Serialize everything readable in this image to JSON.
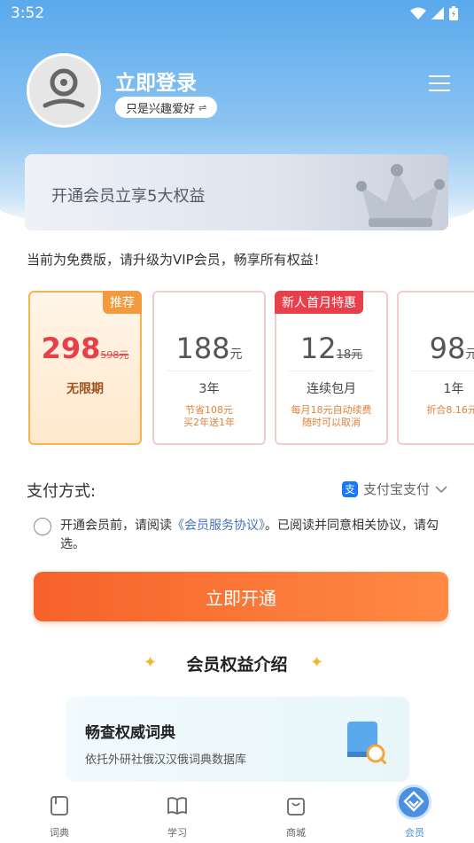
{
  "status_bar": {
    "time": "3:52"
  },
  "header": {
    "login_title": "立即登录",
    "interest_label": "只是兴趣爱好",
    "interest_swap_glyph": "⇌"
  },
  "banner": {
    "text": "开通会员立享5大权益"
  },
  "free_note": "当前为免费版，请升级为VIP会员，畅享所有权益！",
  "plans": [
    {
      "badge": "推荐",
      "price": "298",
      "original": "598元",
      "unit": "",
      "period": "无限期",
      "note1": "",
      "note2": "",
      "selected": true
    },
    {
      "badge": "",
      "price": "188",
      "original": "",
      "unit": "元",
      "period": "3年",
      "note1": "节省108元",
      "note2": "买2年送1年",
      "selected": false
    },
    {
      "badge": "新人首月特惠",
      "price": "12",
      "original": "18元",
      "unit": "",
      "period": "连续包月",
      "note1": "每月18元自动续费",
      "note2": "随时可以取消",
      "selected": false
    },
    {
      "badge": "",
      "price": "98",
      "original": "",
      "unit": "元",
      "period": "1年",
      "note1": "折合8.16元/",
      "note2": "",
      "selected": false
    }
  ],
  "payment": {
    "label": "支付方式:",
    "method": "支付宝支付",
    "alipay_glyph": "支"
  },
  "agreement": {
    "prefix": "开通会员前，请阅读",
    "link": "《会员服务协议》",
    "suffix": "。已阅读并同意相关协议，请勾选。"
  },
  "open_button": "立即开通",
  "benefits": {
    "title": "会员权益介绍",
    "card_title": "畅查权威词典",
    "card_desc": "依托外研社俄汉汉俄词典数据库"
  },
  "tabbar": [
    {
      "label": "词典",
      "icon": "dictionary-icon",
      "active": false
    },
    {
      "label": "学习",
      "icon": "book-open-icon",
      "active": false
    },
    {
      "label": "商城",
      "icon": "shopping-bag-icon",
      "active": false
    },
    {
      "label": "会员",
      "icon": "vip-diamond-icon",
      "active": true
    }
  ],
  "colors": {
    "accent_orange": "#f6622a",
    "brand_blue": "#5aa9ec",
    "price_red": "#e8404a",
    "badge_orange": "#f19a3e"
  }
}
